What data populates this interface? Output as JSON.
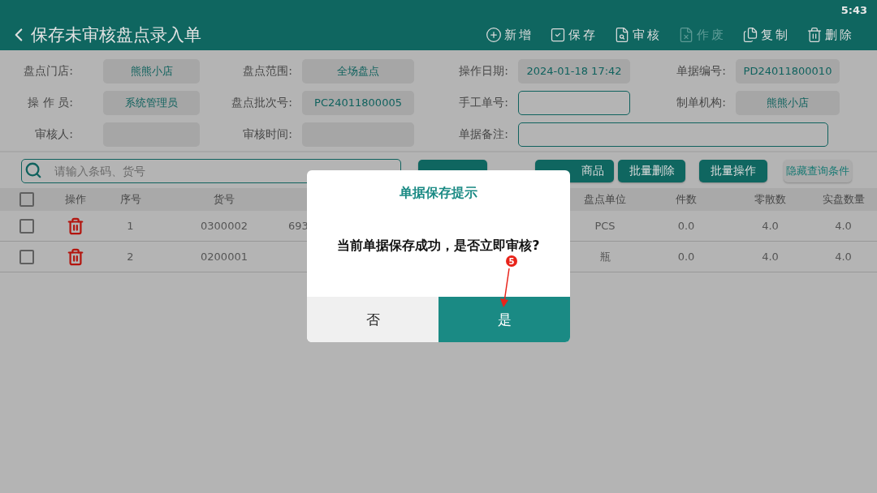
{
  "status_bar": {
    "time": "5:43"
  },
  "header": {
    "title": "保存未审核盘点录入单",
    "actions": [
      {
        "label": "新增",
        "kind": "add",
        "disabled": false
      },
      {
        "label": "保存",
        "kind": "save",
        "disabled": false
      },
      {
        "label": "审核",
        "kind": "audit",
        "disabled": false
      },
      {
        "label": "作废",
        "kind": "void",
        "disabled": true
      },
      {
        "label": "复制",
        "kind": "copy",
        "disabled": false
      },
      {
        "label": "删除",
        "kind": "delete",
        "disabled": false
      }
    ]
  },
  "form": {
    "rows": [
      [
        {
          "label": "盘点门店:",
          "value": "熊熊小店",
          "kind": "readonly"
        },
        {
          "label": "盘点范围:",
          "value": "全场盘点",
          "kind": "readonly"
        },
        {
          "label": "操作日期:",
          "value": "2024-01-18 17:42",
          "kind": "readonly"
        },
        {
          "label": "单据编号:",
          "value": "PD24011800010",
          "kind": "readonly"
        }
      ],
      [
        {
          "label": "操 作 员:",
          "value": "系统管理员",
          "kind": "readonly"
        },
        {
          "label": "盘点批次号:",
          "value": "PC24011800005",
          "kind": "readonly"
        },
        {
          "label": "手工单号:",
          "kind": "input"
        },
        {
          "label": "制单机构:",
          "value": "熊熊小店",
          "kind": "readonly"
        }
      ],
      [
        {
          "label": "审核人:",
          "kind": "readonly"
        },
        {
          "label": "审核时间:",
          "kind": "readonly"
        },
        {
          "label": "单据备注:",
          "kind": "wide_input"
        }
      ]
    ]
  },
  "search": {
    "placeholder": "请输入条码、货号"
  },
  "buttons": [
    {
      "kind": "search"
    },
    {
      "label": "商品",
      "kind": "primary"
    },
    {
      "label": "批量删除",
      "kind": "primary"
    },
    {
      "label": "批量操作",
      "kind": "primary"
    },
    {
      "label": "隐藏查询条件",
      "kind": "secondary"
    }
  ],
  "table": {
    "all_checked": false,
    "columns": [
      "操作",
      "序号",
      "货号",
      "盘点单位",
      "件数",
      "零散数",
      "实盘数量"
    ],
    "rows": [
      {
        "checked": false,
        "seq": "1",
        "code": "0300002",
        "column_4": "693",
        "unit": "PCS",
        "pieces": "0.0",
        "loose": "4.0",
        "actual": "4.0"
      },
      {
        "checked": false,
        "seq": "2",
        "code": "0200001",
        "unit": "瓶",
        "pieces": "0.0",
        "loose": "4.0",
        "actual": "4.0"
      }
    ]
  },
  "dialog": {
    "title": "单据保存提示",
    "message": "当前单据保存成功，是否立即审核?",
    "buttons": [
      {
        "label": "否",
        "primary": false
      },
      {
        "label": "是",
        "primary": true
      }
    ]
  },
  "annotation": {
    "step": "5"
  }
}
